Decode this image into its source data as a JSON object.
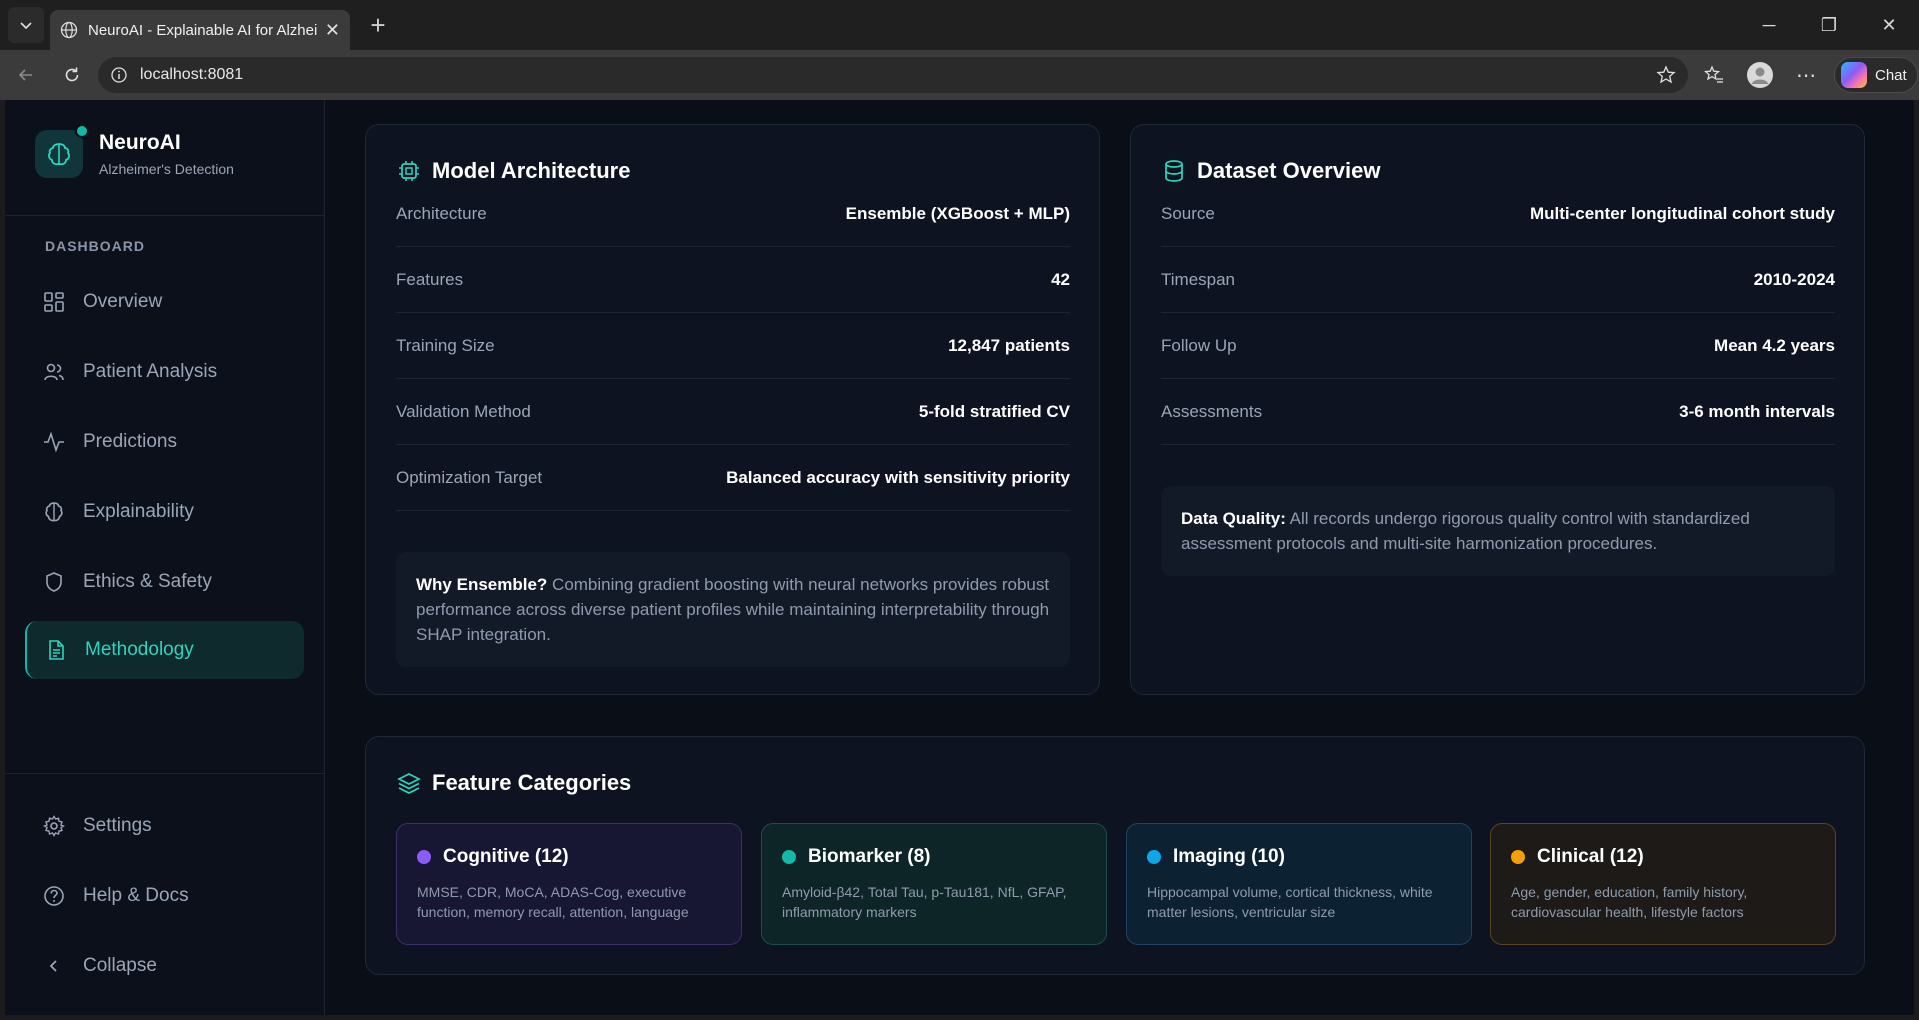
{
  "browser": {
    "tab_title": "NeuroAI - Explainable AI for Alzheimer's",
    "url": "localhost:8081",
    "chat_label": "Chat"
  },
  "sidebar": {
    "brand_name": "NeuroAI",
    "brand_subtitle": "Alzheimer's Detection",
    "section_label": "DASHBOARD",
    "items": [
      {
        "label": "Overview",
        "icon": "grid-icon"
      },
      {
        "label": "Patient Analysis",
        "icon": "users-icon"
      },
      {
        "label": "Predictions",
        "icon": "activity-icon"
      },
      {
        "label": "Explainability",
        "icon": "brain-icon"
      },
      {
        "label": "Ethics & Safety",
        "icon": "shield-icon"
      },
      {
        "label": "Methodology",
        "icon": "document-icon",
        "active": true
      }
    ],
    "bottom_items": [
      {
        "label": "Settings",
        "icon": "gear-icon"
      },
      {
        "label": "Help & Docs",
        "icon": "help-icon"
      },
      {
        "label": "Collapse",
        "icon": "chevron-left-icon"
      }
    ]
  },
  "model_architecture": {
    "title": "Model Architecture",
    "rows": [
      {
        "key": "Architecture",
        "value": "Ensemble (XGBoost + MLP)"
      },
      {
        "key": "Features",
        "value": "42"
      },
      {
        "key": "Training Size",
        "value": "12,847 patients"
      },
      {
        "key": "Validation Method",
        "value": "5-fold stratified CV"
      },
      {
        "key": "Optimization Target",
        "value": "Balanced accuracy with sensitivity priority"
      }
    ],
    "note_bold": "Why Ensemble?",
    "note_text": " Combining gradient boosting with neural networks provides robust performance across diverse patient profiles while maintaining interpretability through SHAP integration."
  },
  "dataset_overview": {
    "title": "Dataset Overview",
    "rows": [
      {
        "key": "Source",
        "value": "Multi-center longitudinal cohort study"
      },
      {
        "key": "Timespan",
        "value": "2010-2024"
      },
      {
        "key": "Follow Up",
        "value": "Mean 4.2 years"
      },
      {
        "key": "Assessments",
        "value": "3-6 month intervals"
      }
    ],
    "note_bold": "Data Quality:",
    "note_text": " All records undergo rigorous quality control with standardized assessment protocols and multi-site harmonization procedures."
  },
  "feature_categories": {
    "title": "Feature Categories",
    "items": [
      {
        "title": "Cognitive (12)",
        "desc": "MMSE, CDR, MoCA, ADAS-Cog, executive function, memory recall, attention, language",
        "color": "#8b5cf6"
      },
      {
        "title": "Biomarker (8)",
        "desc": "Amyloid-β42, Total Tau, p-Tau181, NfL, GFAP, inflammatory markers",
        "color": "#14b8a6"
      },
      {
        "title": "Imaging (10)",
        "desc": "Hippocampal volume, cortical thickness, white matter lesions, ventricular size",
        "color": "#0ea5e9"
      },
      {
        "title": "Clinical (12)",
        "desc": "Age, gender, education, family history, cardiovascular health, lifestyle factors",
        "color": "#f59e0b"
      }
    ]
  }
}
